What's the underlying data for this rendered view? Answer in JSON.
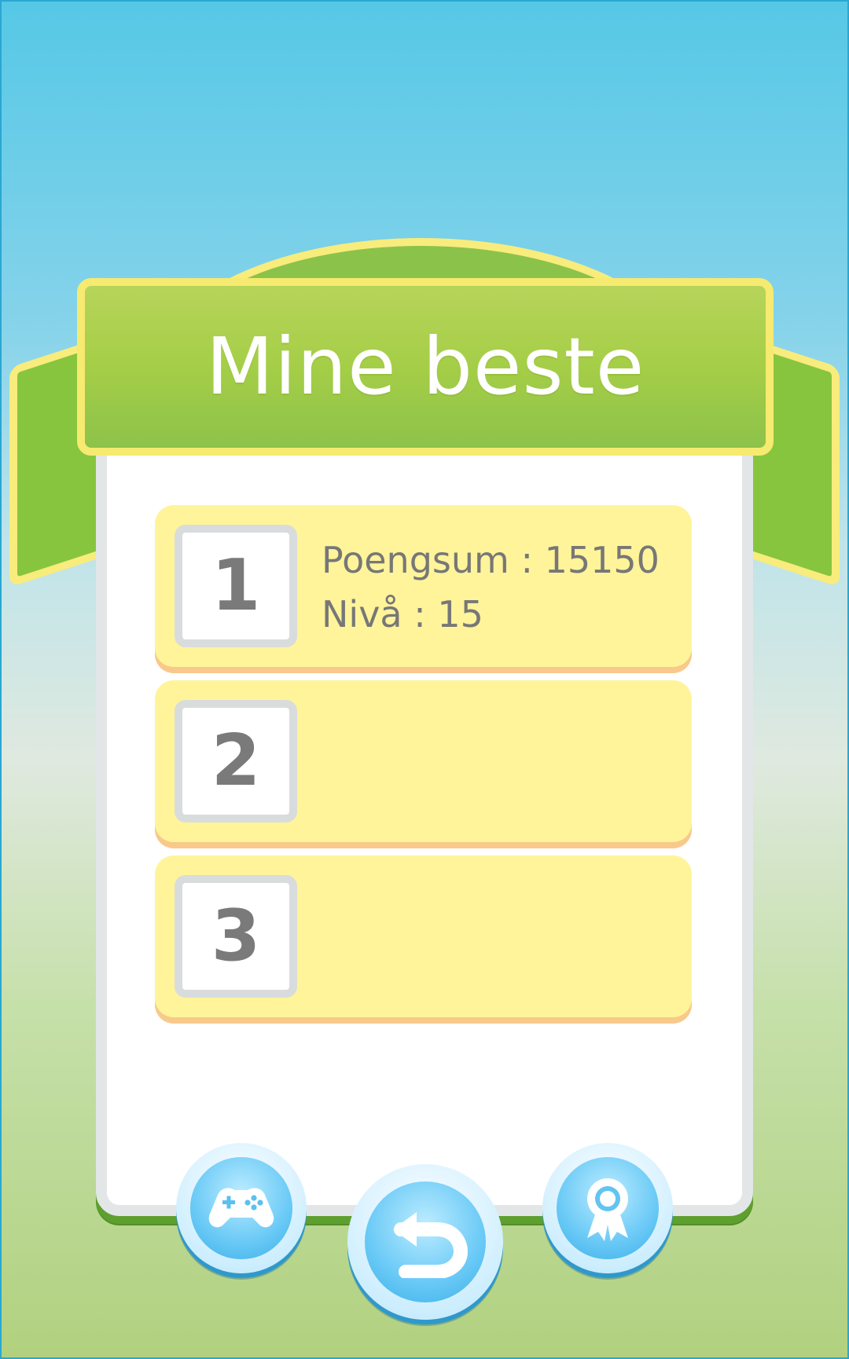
{
  "title": "Mine beste",
  "scores": [
    {
      "rank": "1",
      "score_label": "Poengsum : ",
      "score_value": "15150",
      "level_label": "Nivå : ",
      "level_value": "15"
    },
    {
      "rank": "2",
      "score_label": "",
      "score_value": "",
      "level_label": "",
      "level_value": ""
    },
    {
      "rank": "3",
      "score_label": "",
      "score_value": "",
      "level_label": "",
      "level_value": ""
    }
  ],
  "buttons": {
    "games_icon": "gamepad-icon",
    "back_icon": "back-arrow-icon",
    "achievements_icon": "award-icon"
  },
  "colors": {
    "sky": "#55c8e6",
    "ribbon_green": "#8bc34a",
    "banner_yellow": "#f6ea71",
    "row_yellow": "#fff49a",
    "button_blue": "#3bafe7"
  }
}
